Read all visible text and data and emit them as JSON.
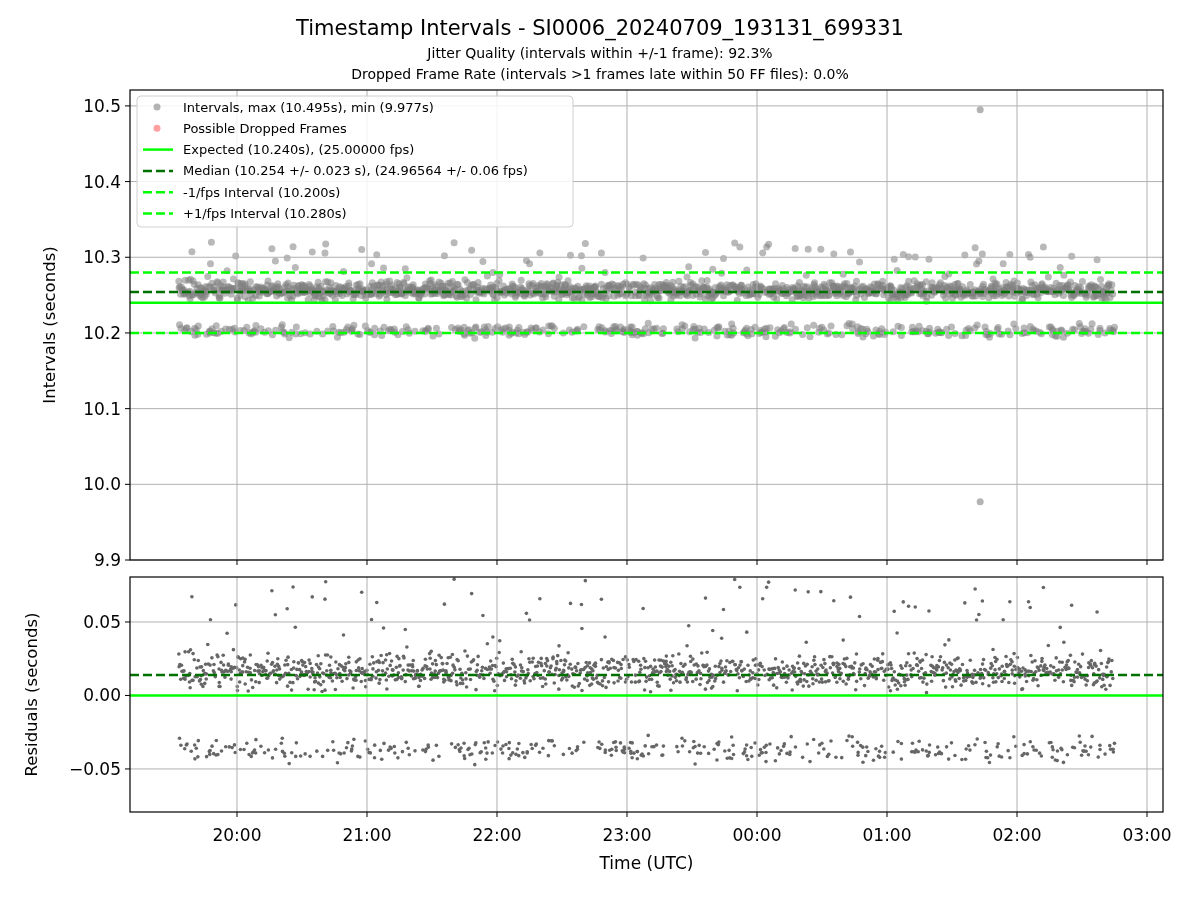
{
  "title": "Timestamp Intervals - SI0006_20240709_193131_699331",
  "subtitles": [
    "Jitter Quality (intervals within +/-1 frame): 92.3%",
    "Dropped Frame Rate (intervals >1 frames late within 50 FF files): 0.0%"
  ],
  "intervals_panel": {
    "chart_data": {
      "type": "scatter",
      "ylabel": "Intervals (seconds)",
      "grid": true,
      "xlim": [
        "2024-07-09T19:10:37",
        "2024-07-10T03:07:23"
      ],
      "ylim": [
        9.9,
        10.521
      ],
      "yticks": [
        {
          "value": 9.9,
          "label": "9.9"
        },
        {
          "value": 10.0,
          "label": "10.0"
        },
        {
          "value": 10.1,
          "label": "10.1"
        },
        {
          "value": 10.2,
          "label": "10.2"
        },
        {
          "value": 10.3,
          "label": "10.3"
        },
        {
          "value": 10.4,
          "label": "10.4"
        },
        {
          "value": 10.5,
          "label": "10.5"
        }
      ],
      "x": [
        "2024-07-10T01:43:00",
        "2024-07-10T01:43:00"
      ],
      "series": [
        {
          "name": "Intervals, max (10.495s), min (9.977s)",
          "color": "#808080",
          "values": [
            10.495,
            9.977
          ]
        },
        {
          "name": "Possible Dropped Frames",
          "color": "#ff6060",
          "values": [
            null,
            null
          ]
        }
      ],
      "ref_lines": [
        {
          "axis": "y",
          "value": 10.24,
          "label": "Expected (10.240s), (25.00000 fps)",
          "color": "#00ff00"
        },
        {
          "axis": "y",
          "value": 10.254,
          "label": "Median (10.254 +/- 0.023 s), (24.96564 +/- 0.06 fps)",
          "color": "#007000"
        },
        {
          "axis": "y",
          "value": 10.2,
          "label": "-1/fps Interval (10.200s)",
          "color": "#00ff00"
        },
        {
          "axis": "y",
          "value": 10.28,
          "label": "+1/fps Interval (10.280s)",
          "color": "#00ff00"
        }
      ],
      "legend": true
    }
  },
  "residuals_panel": {
    "chart_data": {
      "type": "scatter",
      "xlabel": "Time (UTC)",
      "ylabel": "Residuals (seconds)",
      "grid": true,
      "xlim": [
        "2024-07-09T19:10:37",
        "2024-07-10T03:07:23"
      ],
      "ylim": [
        -0.0793,
        0.0806
      ],
      "yticks": [
        {
          "value": -0.05,
          "label": "−0.05"
        },
        {
          "value": 0,
          "label": "0.00"
        },
        {
          "value": 0.05,
          "label": "0.05"
        }
      ],
      "xticks": [
        {
          "value": "2024-07-09T20:00:00",
          "label": "20:00"
        },
        {
          "value": "2024-07-09T21:00:00",
          "label": "21:00"
        },
        {
          "value": "2024-07-09T22:00:00",
          "label": "22:00"
        },
        {
          "value": "2024-07-09T23:00:00",
          "label": "23:00"
        },
        {
          "value": "2024-07-10T00:00:00",
          "label": "00:00"
        },
        {
          "value": "2024-07-10T01:00:00",
          "label": "01:00"
        },
        {
          "value": "2024-07-10T02:00:00",
          "label": "02:00"
        },
        {
          "value": "2024-07-10T03:00:00",
          "label": "03:00"
        }
      ],
      "ref_lines": [
        {
          "axis": "y",
          "value": 0,
          "color": "#00ff00"
        },
        {
          "axis": "y",
          "value": 0.014,
          "color": "#007000"
        }
      ]
    }
  }
}
